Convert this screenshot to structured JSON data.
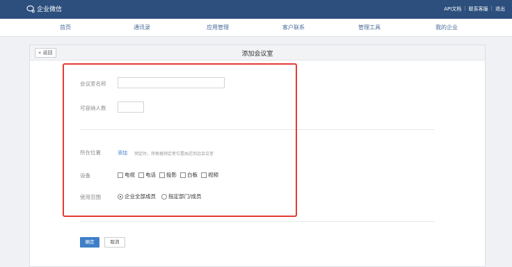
{
  "brand": {
    "name": "企业微信"
  },
  "top_links": [
    "API文档",
    "联系客服",
    "退出"
  ],
  "nav": [
    "首页",
    "通讯录",
    "应用管理",
    "客户联系",
    "管理工具",
    "我的企业"
  ],
  "page": {
    "back_label": "« 返回",
    "title": "添加会议室"
  },
  "form": {
    "room_name_label": "会议室名称",
    "room_name_value": "",
    "capacity_label": "可容纳人数",
    "capacity_value": "",
    "location_label": "所在位置",
    "location_add": "添加",
    "location_hint": "预定时，将根据预定者位置由近到远会议室",
    "equipment_label": "设备",
    "equipment": [
      "电视",
      "电话",
      "投影",
      "白板",
      "视频"
    ],
    "scope_label": "使用范围",
    "scope_options": [
      "企业全部成员",
      "指定部门/成员"
    ],
    "scope_selected": "企业全部成员"
  },
  "actions": {
    "confirm": "确定",
    "cancel": "取消"
  },
  "colors": {
    "topbar": "#2c4f7d",
    "primary": "#3e7fc7",
    "highlight": "#e53935"
  }
}
